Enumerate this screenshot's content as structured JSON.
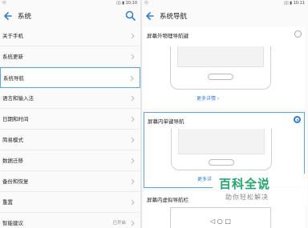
{
  "left": {
    "status": {
      "left": "ⓔ",
      "right": "▯▯ ▮ 10:10"
    },
    "title": "系统",
    "menu": [
      {
        "label": "关于手机"
      },
      {
        "label": "系统更新"
      },
      {
        "label": "系统导航",
        "active": true
      },
      {
        "label": "语言和输入法"
      },
      {
        "label": "日期和时间"
      },
      {
        "label": "简易模式"
      },
      {
        "label": "数据迁移"
      },
      {
        "label": "备份和恢复"
      },
      {
        "label": "重置"
      },
      {
        "label": "智能建议",
        "value": "已开启"
      }
    ]
  },
  "right": {
    "status": {
      "left": "ⓔ",
      "right": "▯▯ ▮ 10:11"
    },
    "title": "系统导航",
    "options": [
      {
        "title": "屏幕外物理导航键",
        "more": "更多详情 ›",
        "selected": false
      },
      {
        "title": "屏幕内单键导航",
        "more": "更多详",
        "selected": true
      },
      {
        "title": "屏幕内虚拟导航栏",
        "navkeys": "◁   ○   □"
      }
    ]
  },
  "watermark": {
    "main": "百科全说",
    "sub": "助你轻松解决"
  },
  "colors": {
    "accent": "#2e7dd7",
    "highlight": "#56a6e8",
    "watermark": "#1fa86b"
  }
}
